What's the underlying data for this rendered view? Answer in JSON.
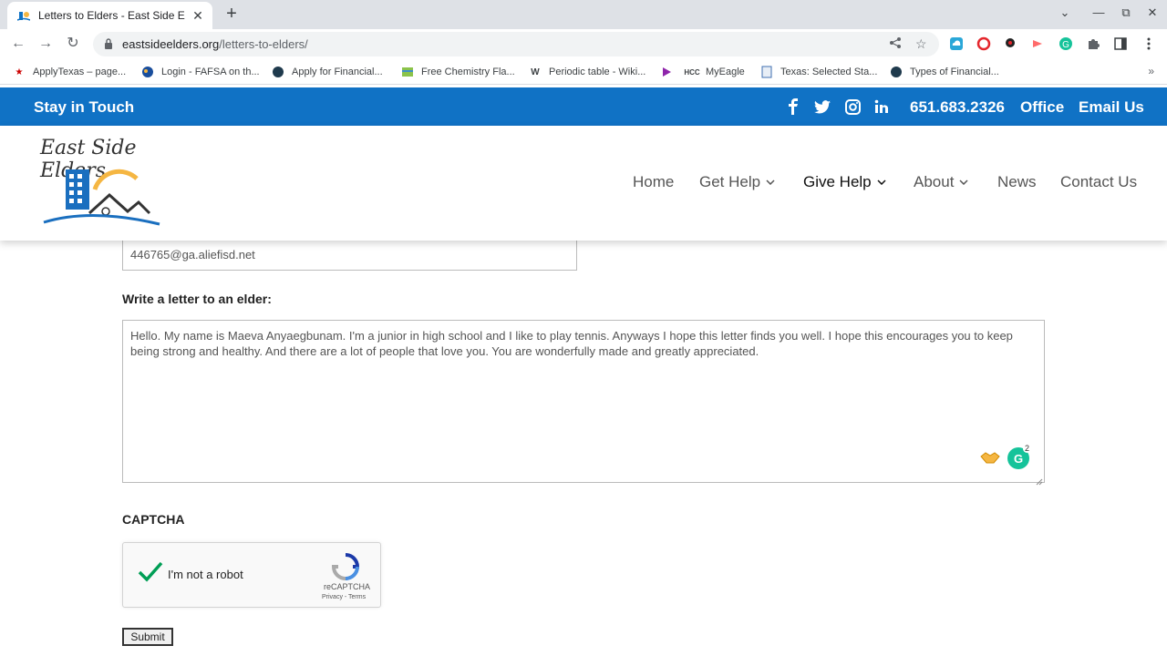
{
  "browser": {
    "tab": {
      "title": "Letters to Elders - East Side Elders",
      "close": "✕"
    },
    "new_tab": "+",
    "window_controls": {
      "dropdown": "⌄",
      "minimize": "—",
      "restore": "⧉",
      "close": "✕"
    },
    "nav": {
      "back": "←",
      "forward": "→",
      "reload": "↻"
    },
    "address": {
      "host": "eastsideelders.org",
      "path": "/letters-to-elders/"
    },
    "bookmarks": [
      {
        "label": "ApplyTexas – page...",
        "icon": "star-icon"
      },
      {
        "label": "Login - FAFSA on th...",
        "icon": "globe-icon"
      },
      {
        "label": "Apply for Financial...",
        "icon": "fsa-icon"
      },
      {
        "label": "Free Chemistry Fla...",
        "icon": "flashcard-icon"
      },
      {
        "label": "Periodic table - Wiki...",
        "icon": "wikipedia-icon"
      },
      {
        "label": "",
        "icon": "play-icon"
      },
      {
        "label": "MyEagle",
        "icon": "hcc-icon"
      },
      {
        "label": "Texas: Selected Sta...",
        "icon": "document-icon"
      },
      {
        "label": "Types of Financial...",
        "icon": "fsa-icon"
      }
    ],
    "bookmarks_more": "»"
  },
  "site": {
    "topbar": {
      "stay_in_touch": "Stay in Touch",
      "phone": "651.683.2326",
      "office": "Office",
      "email_us": "Email Us",
      "social": [
        "facebook-icon",
        "twitter-icon",
        "instagram-icon",
        "linkedin-icon"
      ]
    },
    "logo_text": "East Side Elders",
    "nav": [
      {
        "label": "Home",
        "dropdown": false
      },
      {
        "label": "Get Help",
        "dropdown": true
      },
      {
        "label": "Give Help",
        "dropdown": true,
        "active": true
      },
      {
        "label": "About",
        "dropdown": true
      },
      {
        "label": "News",
        "dropdown": false
      },
      {
        "label": "Contact Us",
        "dropdown": false
      }
    ],
    "colors": {
      "topbar": "#1072c5",
      "grammarly": "#15c39a",
      "check": "#009e55"
    }
  },
  "form": {
    "email_value": "446765@ga.aliefisd.net",
    "letter_label": "Write a letter to an elder:",
    "letter_value": "Hello. My name is Maeva Anyaegbunam. I'm a junior in high school and I like to play tennis. Anyways I hope this letter finds you well. I hope this encourages you to keep being strong and healthy. And there are a lot of people that love you. You are wonderfully made and greatly appreciated.",
    "grammarly_count": "2",
    "captcha_label": "CAPTCHA",
    "captcha": {
      "text": "I'm not a robot",
      "brand": "reCAPTCHA",
      "links": "Privacy - Terms",
      "checked": true
    },
    "submit_label": "Submit"
  }
}
